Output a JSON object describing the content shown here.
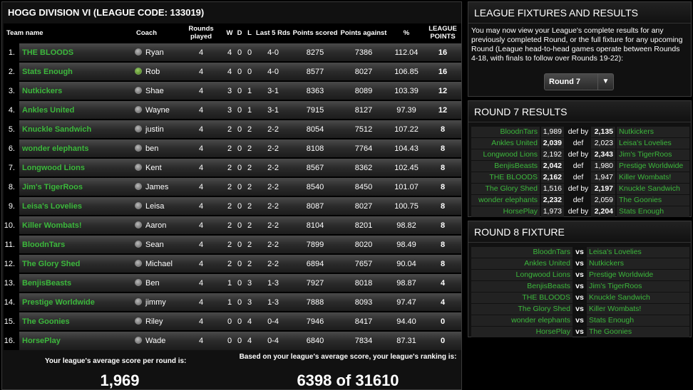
{
  "division_title": "HOGG DIVISION VI (LEAGUE CODE: 133019)",
  "ladder_headers": {
    "team": "Team name",
    "coach": "Coach",
    "rounds": "Rounds played",
    "w": "W",
    "d": "D",
    "l": "L",
    "last5": "Last 5 Rds",
    "pts_scored": "Points scored",
    "pts_against": "Points against",
    "pct": "%",
    "league_points": "LEAGUE POINTS"
  },
  "ladder": [
    {
      "pos": "1.",
      "team": "THE BLOODS",
      "coach": "Ryan",
      "avatar": "grey",
      "rounds": "4",
      "w": "4",
      "d": "0",
      "l": "0",
      "last5": "4-0",
      "scored": "8275",
      "against": "7386",
      "pct": "112.04",
      "lp": "16"
    },
    {
      "pos": "2.",
      "team": "Stats Enough",
      "coach": "Rob",
      "avatar": "green",
      "rounds": "4",
      "w": "4",
      "d": "0",
      "l": "0",
      "last5": "4-0",
      "scored": "8577",
      "against": "8027",
      "pct": "106.85",
      "lp": "16"
    },
    {
      "pos": "3.",
      "team": "Nutkickers",
      "coach": "Shae",
      "avatar": "grey",
      "rounds": "4",
      "w": "3",
      "d": "0",
      "l": "1",
      "last5": "3-1",
      "scored": "8363",
      "against": "8089",
      "pct": "103.39",
      "lp": "12"
    },
    {
      "pos": "4.",
      "team": "Ankles United",
      "coach": "Wayne",
      "avatar": "grey",
      "rounds": "4",
      "w": "3",
      "d": "0",
      "l": "1",
      "last5": "3-1",
      "scored": "7915",
      "against": "8127",
      "pct": "97.39",
      "lp": "12"
    },
    {
      "pos": "5.",
      "team": "Knuckle Sandwich",
      "coach": "justin",
      "avatar": "grey",
      "rounds": "4",
      "w": "2",
      "d": "0",
      "l": "2",
      "last5": "2-2",
      "scored": "8054",
      "against": "7512",
      "pct": "107.22",
      "lp": "8"
    },
    {
      "pos": "6.",
      "team": "wonder elephants",
      "coach": "ben",
      "avatar": "grey",
      "rounds": "4",
      "w": "2",
      "d": "0",
      "l": "2",
      "last5": "2-2",
      "scored": "8108",
      "against": "7764",
      "pct": "104.43",
      "lp": "8"
    },
    {
      "pos": "7.",
      "team": "Longwood Lions",
      "coach": "Kent",
      "avatar": "grey",
      "rounds": "4",
      "w": "2",
      "d": "0",
      "l": "2",
      "last5": "2-2",
      "scored": "8567",
      "against": "8362",
      "pct": "102.45",
      "lp": "8"
    },
    {
      "pos": "8.",
      "team": "Jim's TigerRoos",
      "coach": "James",
      "avatar": "grey",
      "rounds": "4",
      "w": "2",
      "d": "0",
      "l": "2",
      "last5": "2-2",
      "scored": "8540",
      "against": "8450",
      "pct": "101.07",
      "lp": "8"
    },
    {
      "pos": "9.",
      "team": "Leisa's Lovelies",
      "coach": "Leisa",
      "avatar": "grey",
      "rounds": "4",
      "w": "2",
      "d": "0",
      "l": "2",
      "last5": "2-2",
      "scored": "8087",
      "against": "8027",
      "pct": "100.75",
      "lp": "8"
    },
    {
      "pos": "10.",
      "team": "Killer Wombats!",
      "coach": "Aaron",
      "avatar": "grey",
      "rounds": "4",
      "w": "2",
      "d": "0",
      "l": "2",
      "last5": "2-2",
      "scored": "8104",
      "against": "8201",
      "pct": "98.82",
      "lp": "8"
    },
    {
      "pos": "11.",
      "team": "BloodnTars",
      "coach": "Sean",
      "avatar": "grey",
      "rounds": "4",
      "w": "2",
      "d": "0",
      "l": "2",
      "last5": "2-2",
      "scored": "7899",
      "against": "8020",
      "pct": "98.49",
      "lp": "8"
    },
    {
      "pos": "12.",
      "team": "The Glory Shed",
      "coach": "Michael",
      "avatar": "grey",
      "rounds": "4",
      "w": "2",
      "d": "0",
      "l": "2",
      "last5": "2-2",
      "scored": "6894",
      "against": "7657",
      "pct": "90.04",
      "lp": "8"
    },
    {
      "pos": "13.",
      "team": "BenjisBeasts",
      "coach": "Ben",
      "avatar": "grey",
      "rounds": "4",
      "w": "1",
      "d": "0",
      "l": "3",
      "last5": "1-3",
      "scored": "7927",
      "against": "8018",
      "pct": "98.87",
      "lp": "4"
    },
    {
      "pos": "14.",
      "team": "Prestige Worldwide",
      "coach": "jimmy",
      "avatar": "grey",
      "rounds": "4",
      "w": "1",
      "d": "0",
      "l": "3",
      "last5": "1-3",
      "scored": "7888",
      "against": "8093",
      "pct": "97.47",
      "lp": "4"
    },
    {
      "pos": "15.",
      "team": "The Goonies",
      "coach": "Riley",
      "avatar": "grey",
      "rounds": "4",
      "w": "0",
      "d": "0",
      "l": "4",
      "last5": "0-4",
      "scored": "7946",
      "against": "8417",
      "pct": "94.40",
      "lp": "0"
    },
    {
      "pos": "16.",
      "team": "HorsePlay",
      "coach": "Wade",
      "avatar": "grey",
      "rounds": "4",
      "w": "0",
      "d": "0",
      "l": "4",
      "last5": "0-4",
      "scored": "6840",
      "against": "7834",
      "pct": "87.31",
      "lp": "0"
    }
  ],
  "summary": {
    "avg_label": "Your league's average score per round is:",
    "avg_value": "1,969",
    "rank_label": "Based on your league's average score, your league's ranking is:",
    "rank_value": "6398 of 31610"
  },
  "fixtures_panel": {
    "title": "LEAGUE FIXTURES AND RESULTS",
    "text": "You may now view your League's complete results for any previously completed Round, or the full fixture for any upcoming Round (League head-to-head games operate between Rounds 4-18, with finals to follow over Rounds 19-22):",
    "selected_round": "Round 7"
  },
  "results_panel": {
    "title": "ROUND 7 RESULTS",
    "results": [
      {
        "team1": "BloodnTars",
        "s1": "1,989",
        "mid": "def by",
        "s2": "2,135",
        "team2": "Nutkickers",
        "winner": 2
      },
      {
        "team1": "Ankles United",
        "s1": "2,039",
        "mid": "def",
        "s2": "2,023",
        "team2": "Leisa's Lovelies",
        "winner": 1
      },
      {
        "team1": "Longwood Lions",
        "s1": "2,192",
        "mid": "def by",
        "s2": "2,343",
        "team2": "Jim's TigerRoos",
        "winner": 2
      },
      {
        "team1": "BenjisBeasts",
        "s1": "2,042",
        "mid": "def",
        "s2": "1,980",
        "team2": "Prestige Worldwide",
        "winner": 1
      },
      {
        "team1": "THE BLOODS",
        "s1": "2,162",
        "mid": "def",
        "s2": "1,947",
        "team2": "Killer Wombats!",
        "winner": 1
      },
      {
        "team1": "The Glory Shed",
        "s1": "1,516",
        "mid": "def by",
        "s2": "2,197",
        "team2": "Knuckle Sandwich",
        "winner": 2
      },
      {
        "team1": "wonder elephants",
        "s1": "2,232",
        "mid": "def",
        "s2": "2,059",
        "team2": "The Goonies",
        "winner": 1
      },
      {
        "team1": "HorsePlay",
        "s1": "1,973",
        "mid": "def by",
        "s2": "2,204",
        "team2": "Stats Enough",
        "winner": 2
      }
    ]
  },
  "fixture_panel": {
    "title": "ROUND 8 FIXTURE",
    "vs_label": "vs",
    "fixtures": [
      {
        "team1": "BloodnTars",
        "team2": "Leisa's Lovelies"
      },
      {
        "team1": "Ankles United",
        "team2": "Nutkickers"
      },
      {
        "team1": "Longwood Lions",
        "team2": "Prestige Worldwide"
      },
      {
        "team1": "BenjisBeasts",
        "team2": "Jim's TigerRoos"
      },
      {
        "team1": "THE BLOODS",
        "team2": "Knuckle Sandwich"
      },
      {
        "team1": "The Glory Shed",
        "team2": "Killer Wombats!"
      },
      {
        "team1": "wonder elephants",
        "team2": "Stats Enough"
      },
      {
        "team1": "HorsePlay",
        "team2": "The Goonies"
      }
    ]
  },
  "colors": {
    "team_green": "#3cb83c",
    "background": "#000000"
  }
}
